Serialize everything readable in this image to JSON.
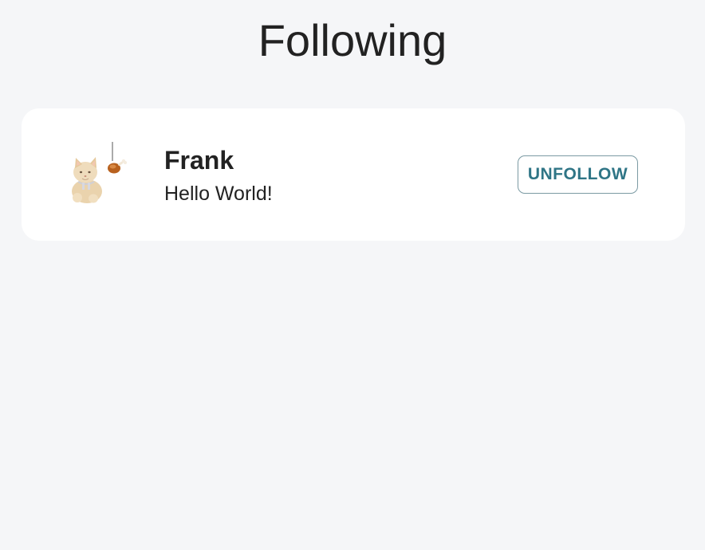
{
  "page": {
    "title": "Following"
  },
  "following": [
    {
      "avatar_icon": "cat-with-drumstick-avatar",
      "name": "Frank",
      "bio": "Hello World!",
      "action_label": "UNFOLLOW"
    }
  ],
  "colors": {
    "background": "#f5f6f8",
    "card": "#ffffff",
    "text": "#222222",
    "accent": "#2f7586",
    "button_border": "#7b9aa3"
  }
}
